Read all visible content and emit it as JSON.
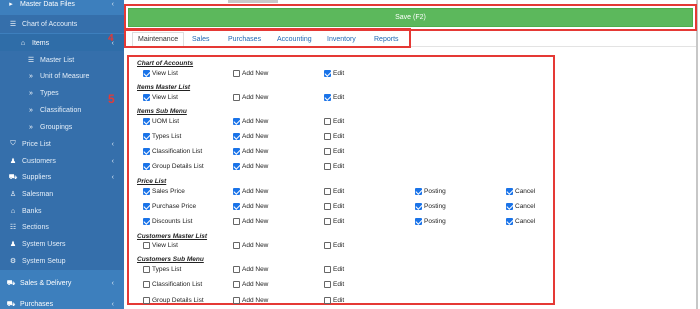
{
  "sidebar": {
    "items": [
      {
        "icon": "chevron-icon",
        "glyph": "▸",
        "label": "Master Data Files",
        "chev": "‹",
        "kind": "header"
      },
      {
        "icon": "list-icon",
        "glyph": "☰",
        "label": "Chart of Accounts",
        "chev": "",
        "kind": "sub"
      },
      {
        "icon": "home-icon",
        "glyph": "⌂",
        "label": "Items",
        "chev": "‹",
        "kind": "active"
      },
      {
        "icon": "list-icon",
        "glyph": "☰",
        "label": "Master List",
        "chev": "",
        "kind": "subsub"
      },
      {
        "icon": "angle-right-icon",
        "glyph": "»",
        "label": "Unit of Measure",
        "chev": "",
        "kind": "subsub"
      },
      {
        "icon": "angle-right-icon",
        "glyph": "»",
        "label": "Types",
        "chev": "",
        "kind": "subsub"
      },
      {
        "icon": "angle-right-icon",
        "glyph": "»",
        "label": "Classification",
        "chev": "",
        "kind": "subsub"
      },
      {
        "icon": "angle-right-icon",
        "glyph": "»",
        "label": "Groupings",
        "chev": "",
        "kind": "subsub"
      },
      {
        "icon": "tag-icon",
        "glyph": "⛉",
        "label": "Price List",
        "chev": "‹",
        "kind": "sub"
      },
      {
        "icon": "customers-icon",
        "glyph": "♟",
        "label": "Customers",
        "chev": "‹",
        "kind": "sub"
      },
      {
        "icon": "truck-icon",
        "glyph": "⛟",
        "label": "Suppliers",
        "chev": "‹",
        "kind": "sub"
      },
      {
        "icon": "user-icon",
        "glyph": "♙",
        "label": "Salesman",
        "chev": "",
        "kind": "sub"
      },
      {
        "icon": "bank-icon",
        "glyph": "⌂",
        "label": "Banks",
        "chev": "",
        "kind": "sub"
      },
      {
        "icon": "sections-icon",
        "glyph": "☷",
        "label": "Sections",
        "chev": "",
        "kind": "sub"
      },
      {
        "icon": "users-icon",
        "glyph": "♟",
        "label": "System Users",
        "chev": "",
        "kind": "sub"
      },
      {
        "icon": "gear-icon",
        "glyph": "⚙",
        "label": "System Setup",
        "chev": "",
        "kind": "sub"
      },
      {
        "icon": "sales-icon",
        "glyph": "⛟",
        "label": "Sales & Delivery",
        "chev": "‹",
        "kind": "header"
      },
      {
        "icon": "cart-icon",
        "glyph": "⛟",
        "label": "Purchases",
        "chev": "‹",
        "kind": "header"
      }
    ]
  },
  "save": {
    "label": "Save (F2)"
  },
  "tabs": [
    "Maintenance",
    "Sales",
    "Purchases",
    "Accounting",
    "Inventory",
    "Reports"
  ],
  "annotations": {
    "tabs": "4",
    "content": "5"
  },
  "sections": [
    {
      "title": "Chart of Accounts",
      "rows": [
        [
          {
            "label": "View List",
            "checked": true
          },
          {
            "label": "Add New",
            "checked": false
          },
          {
            "label": "Edit",
            "checked": true
          }
        ]
      ]
    },
    {
      "title": "Items Master List",
      "rows": [
        [
          {
            "label": "View List",
            "checked": true
          },
          {
            "label": "Add New",
            "checked": false
          },
          {
            "label": "Edit",
            "checked": true
          }
        ]
      ]
    },
    {
      "title": "Items Sub Menu",
      "rows": [
        [
          {
            "label": "UOM List",
            "checked": true
          },
          {
            "label": "Add New",
            "checked": true
          },
          {
            "label": "Edit",
            "checked": false
          }
        ],
        [
          {
            "label": "Types List",
            "checked": true
          },
          {
            "label": "Add New",
            "checked": true
          },
          {
            "label": "Edit",
            "checked": false
          }
        ],
        [
          {
            "label": "Classification List",
            "checked": true
          },
          {
            "label": "Add New",
            "checked": true
          },
          {
            "label": "Edit",
            "checked": false
          }
        ],
        [
          {
            "label": "Group Details List",
            "checked": true
          },
          {
            "label": "Add New",
            "checked": true
          },
          {
            "label": "Edit",
            "checked": false
          }
        ]
      ]
    },
    {
      "title": "Price List",
      "rows": [
        [
          {
            "label": "Sales Price",
            "checked": true
          },
          {
            "label": "Add New",
            "checked": true
          },
          {
            "label": "Edit",
            "checked": false
          },
          {
            "label": "Posting",
            "checked": true
          },
          {
            "label": "Cancel",
            "checked": true
          }
        ],
        [
          {
            "label": "Purchase Price",
            "checked": true
          },
          {
            "label": "Add New",
            "checked": true
          },
          {
            "label": "Edit",
            "checked": false
          },
          {
            "label": "Posting",
            "checked": true
          },
          {
            "label": "Cancel",
            "checked": true
          }
        ],
        [
          {
            "label": "Discounts List",
            "checked": true
          },
          {
            "label": "Add New",
            "checked": false
          },
          {
            "label": "Edit",
            "checked": false
          },
          {
            "label": "Posting",
            "checked": true
          },
          {
            "label": "Cancel",
            "checked": true
          }
        ]
      ]
    },
    {
      "title": "Customers Master List",
      "rows": [
        [
          {
            "label": "View List",
            "checked": false
          },
          {
            "label": "Add New",
            "checked": false
          },
          {
            "label": "Edit",
            "checked": false
          }
        ]
      ]
    },
    {
      "title": "Customers Sub Menu",
      "rows": [
        [
          {
            "label": "Types List",
            "checked": false
          },
          {
            "label": "Add New",
            "checked": false
          },
          {
            "label": "Edit",
            "checked": false
          }
        ],
        [
          {
            "label": "Classification List",
            "checked": false
          },
          {
            "label": "Add New",
            "checked": false
          },
          {
            "label": "Edit",
            "checked": false
          }
        ],
        [
          {
            "label": "Group Details List",
            "checked": false
          },
          {
            "label": "Add New",
            "checked": false
          },
          {
            "label": "Edit",
            "checked": false
          }
        ]
      ]
    }
  ],
  "colors": {
    "sidebar": "#3d7fbd",
    "save": "#5cb85c",
    "annotation": "#e53935",
    "check": "#1a73e8"
  }
}
